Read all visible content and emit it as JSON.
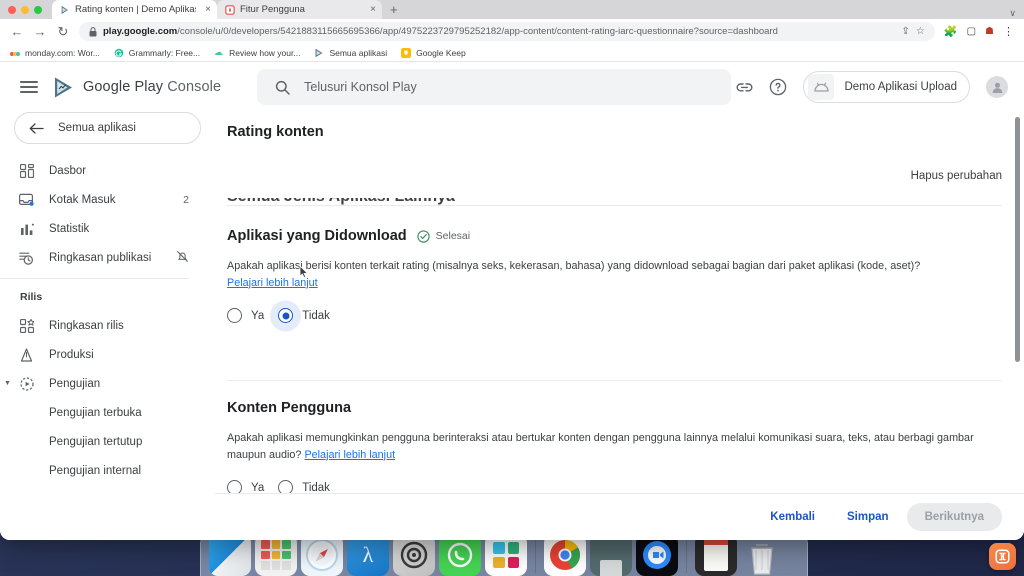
{
  "browser": {
    "tabs": [
      {
        "title": "Rating konten | Demo Aplikasi",
        "favicon": "google-play-console-icon",
        "active": true,
        "close_label": "×"
      },
      {
        "title": "Fitur Pengguna",
        "favicon": "app-icon",
        "active": false,
        "close_label": "×"
      }
    ],
    "new_tab_label": "+",
    "tabstrip_overflow": "∨",
    "nav": {
      "back": "←",
      "forward": "→",
      "reload": "↻"
    },
    "omnibox": {
      "lock_icon": "lock-icon",
      "url_domain": "play.google.com",
      "url_path": "/console/u/0/developers/5421883115665695366/app/4975223729795252182/app-content/content-rating-iarc-questionnaire?source=dashboard",
      "share_icon": "share-icon",
      "bookmark_icon": "star-icon"
    },
    "toolbar_icons": [
      "extensions-icon",
      "side-panel-icon",
      "profile-icon",
      "chrome-menu-icon"
    ],
    "bookmarks": [
      {
        "label": "monday.com: Wor...",
        "icon": "monday-icon"
      },
      {
        "label": "Grammarly: Free...",
        "icon": "grammarly-icon"
      },
      {
        "label": "Review how your...",
        "icon": "cloud-icon"
      },
      {
        "label": "Semua aplikasi",
        "icon": "google-play-console-icon"
      },
      {
        "label": "Google Keep",
        "icon": "keep-icon"
      }
    ]
  },
  "header": {
    "menu_icon": "hamburger-menu-icon",
    "brand_google_play": "Google Play",
    "brand_console": "Console",
    "search": {
      "icon": "search-icon",
      "placeholder": "Telusuri Konsol Play",
      "value": ""
    },
    "link_icon": "link-icon",
    "help_icon": "help-circle-icon",
    "app_chip": {
      "icon": "android-app-icon",
      "label": "Demo Aplikasi Upload"
    },
    "avatar": "account-avatar"
  },
  "sidebar": {
    "all_apps": {
      "icon": "arrow-left-icon",
      "label": "Semua aplikasi"
    },
    "items": [
      {
        "label": "Dasbor",
        "icon": "dashboard-icon",
        "trailing": ""
      },
      {
        "label": "Kotak Masuk",
        "icon": "inbox-icon",
        "trailing": "2"
      },
      {
        "label": "Statistik",
        "icon": "statistics-bar-icon",
        "trailing": ""
      },
      {
        "label": "Ringkasan publikasi",
        "icon": "publishing-overview-icon",
        "trailing": "notification-off-icon"
      }
    ],
    "group_title": "Rilis",
    "release_items": [
      {
        "label": "Ringkasan rilis",
        "icon": "release-overview-icon",
        "expandable": false,
        "sub": false
      },
      {
        "label": "Produksi",
        "icon": "production-icon",
        "expandable": false,
        "sub": false
      },
      {
        "label": "Pengujian",
        "icon": "testing-icon",
        "expandable": true,
        "sub": false
      },
      {
        "label": "Pengujian terbuka",
        "icon": "",
        "expandable": false,
        "sub": true
      },
      {
        "label": "Pengujian tertutup",
        "icon": "",
        "expandable": false,
        "sub": true
      },
      {
        "label": "Pengujian internal",
        "icon": "",
        "expandable": false,
        "sub": true
      }
    ]
  },
  "main": {
    "page_title": "Rating konten",
    "discard_changes": "Hapus perubahan",
    "scrolled_heading": "Semua Jenis Aplikasi Lainnya",
    "sections": [
      {
        "title": "Aplikasi yang Didownload",
        "status_badge": {
          "icon": "check-circle-icon",
          "label": "Selesai",
          "color": "#3c8c5c"
        },
        "question": "Apakah aplikasi berisi konten terkait rating (misalnya seks, kekerasan, bahasa) yang didownload sebagai bagian dari paket aplikasi (kode, aset)?",
        "learn_more": "Pelajari lebih lanjut",
        "learn_more_inline": false,
        "options": [
          {
            "label": "Ya",
            "selected": false
          },
          {
            "label": "Tidak",
            "selected": true
          }
        ]
      },
      {
        "title": "Konten Pengguna",
        "status_badge": null,
        "question": "Apakah aplikasi memungkinkan pengguna berinteraksi atau bertukar konten dengan pengguna lainnya melalui komunikasi suara, teks, atau berbagi gambar maupun audio?",
        "learn_more": "Pelajari lebih lanjut",
        "learn_more_inline": true,
        "options": [
          {
            "label": "Ya",
            "selected": false
          },
          {
            "label": "Tidak",
            "selected": false
          }
        ]
      }
    ],
    "footer": {
      "back": "Kembali",
      "save": "Simpan",
      "next": "Berikutnya",
      "next_disabled": true
    }
  },
  "colors": {
    "accent_blue": "#1a56c4",
    "link_blue": "#1a73e8",
    "success_green": "#3c8c5c",
    "surface_grey": "#f1f3f4"
  },
  "dock": {
    "items": [
      {
        "name": "finder-icon",
        "color": "#2aa8f2"
      },
      {
        "name": "launchpad-icon",
        "color": "#e8e8e8"
      },
      {
        "name": "safari-icon",
        "color": "#e6f2fb"
      },
      {
        "name": "xcode-icon",
        "color": "#1a8fe3"
      },
      {
        "name": "settings-icon",
        "color": "#d8d8d8"
      },
      {
        "name": "whatsapp-icon",
        "color": "#4ad04a"
      },
      {
        "name": "slack-icon",
        "color": "#ffffff"
      },
      {
        "name": "separator",
        "color": ""
      },
      {
        "name": "chrome-icon",
        "color": "#ffffff"
      },
      {
        "name": "terminal-icon",
        "color": "#4d6163"
      },
      {
        "name": "zoom-icon",
        "color": "#2d8cff"
      },
      {
        "name": "separator",
        "color": ""
      },
      {
        "name": "documents-stack-icon",
        "color": "#e0ddd6"
      },
      {
        "name": "trash-icon",
        "color": "#d6d8da"
      }
    ]
  },
  "floating_widget": {
    "name": "support-widget-button",
    "glyph": "⎇",
    "color": "#ee6f3c"
  }
}
